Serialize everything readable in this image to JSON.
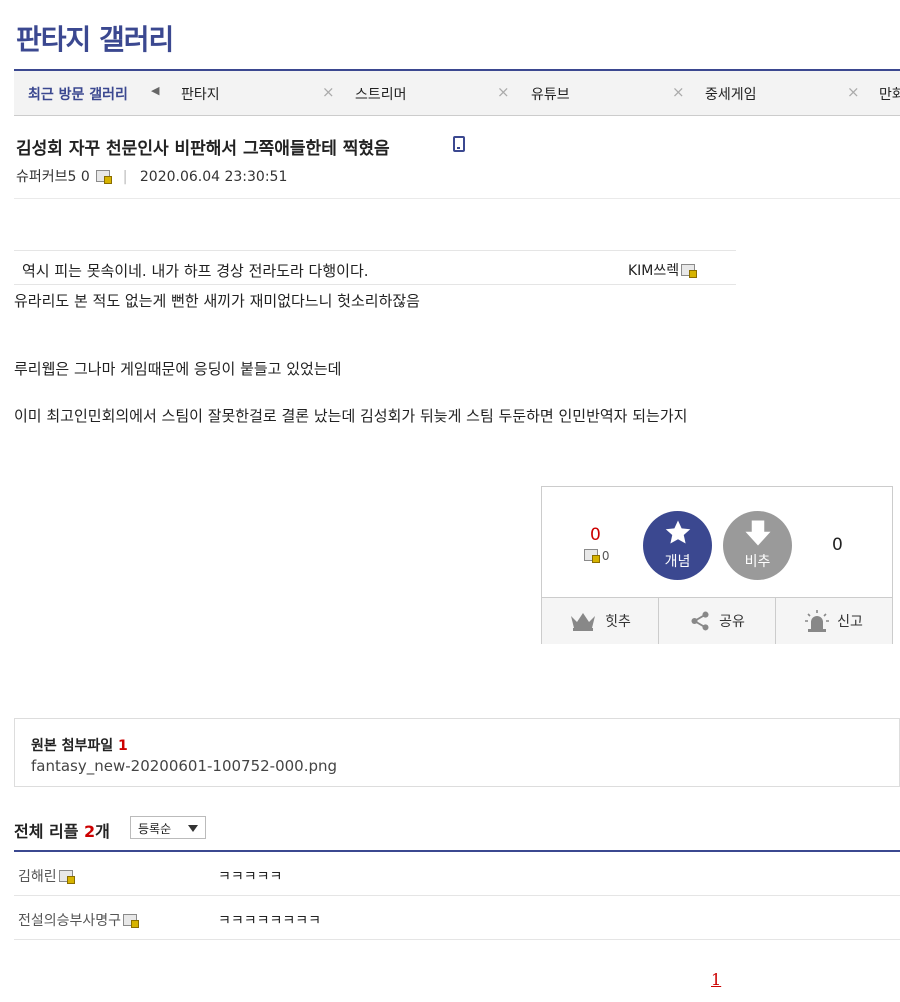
{
  "gallery": {
    "title": "판타지 갤러리"
  },
  "recent": {
    "label": "최근 방문 갤러리",
    "arrow": "◀",
    "items": [
      "판타지",
      "스트리머",
      "유튜브",
      "중세게임",
      "만화"
    ],
    "close": "×"
  },
  "post": {
    "title": "김성회 자꾸 천문인사 비판해서 그쪽애들한테 찍혔음",
    "author": "슈퍼커브5 0",
    "separator": "|",
    "date": "2020.06.04 23:30:51"
  },
  "quote": {
    "text": "역시 피는 못속이네. 내가 하프 경상 전라도라 다행이다.",
    "author": "KIM쓰렉"
  },
  "body": [
    "유라리도 본 적도 없는게 뻔한 새끼가 재미없다느니 헛소리하잖음",
    "루리웹은 그나마 게임때문에 응딩이 붙들고 있었는데",
    "이미 최고인민회의에서 스팀이 잘못한걸로 결론 났는데 김성회가 뒤늦게 스팀 두둔하면   인민반역자 되는가지"
  ],
  "vote": {
    "up_count": "0",
    "fix_count": "0",
    "up_label": "개념",
    "down_label": "비추",
    "down_count": "0",
    "actions": [
      "힛추",
      "공유",
      "신고"
    ]
  },
  "attach": {
    "title": "원본 첨부파일",
    "count": "1",
    "filename": "fantasy_new-20200601-100752-000.png"
  },
  "comments": {
    "title": "전체 리플",
    "count": "2",
    "unit": "개",
    "sort": "등록순",
    "items": [
      {
        "author": "김해린",
        "text": "ㅋㅋㅋㅋㅋ"
      },
      {
        "author": "전설의승부사명구",
        "text": "ㅋㅋㅋㅋㅋㅋㅋㅋ"
      }
    ]
  },
  "pager": {
    "current": "1"
  }
}
